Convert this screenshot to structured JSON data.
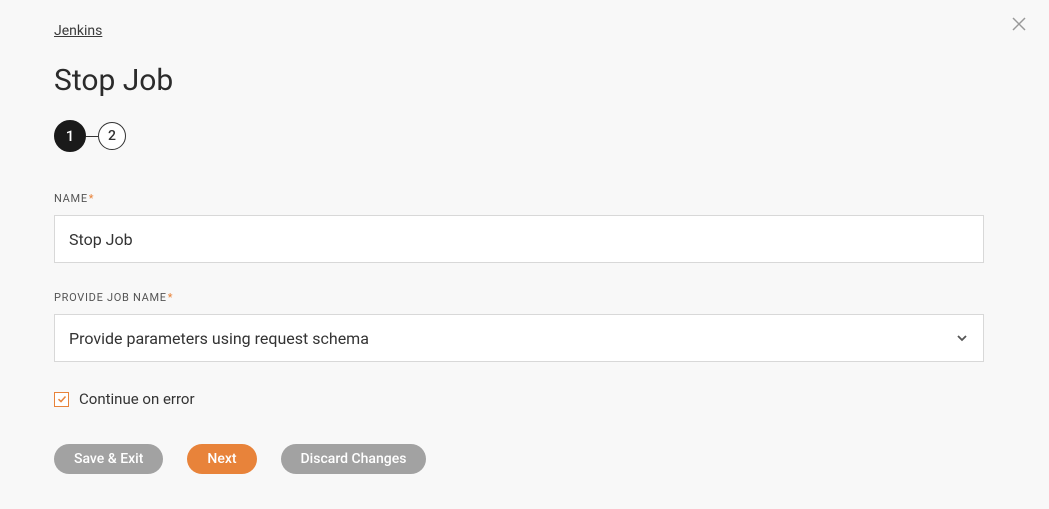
{
  "breadcrumb": "Jenkins",
  "title": "Stop Job",
  "stepper": {
    "steps": [
      "1",
      "2"
    ],
    "active_index": 0
  },
  "form": {
    "name": {
      "label": "NAME",
      "required": "*",
      "value": "Stop Job"
    },
    "job_name": {
      "label": "PROVIDE JOB NAME",
      "required": "*",
      "selected": "Provide parameters using request schema"
    },
    "continue_on_error": {
      "label": "Continue on error",
      "checked": true
    }
  },
  "buttons": {
    "save_exit": "Save & Exit",
    "next": "Next",
    "discard": "Discard Changes"
  }
}
